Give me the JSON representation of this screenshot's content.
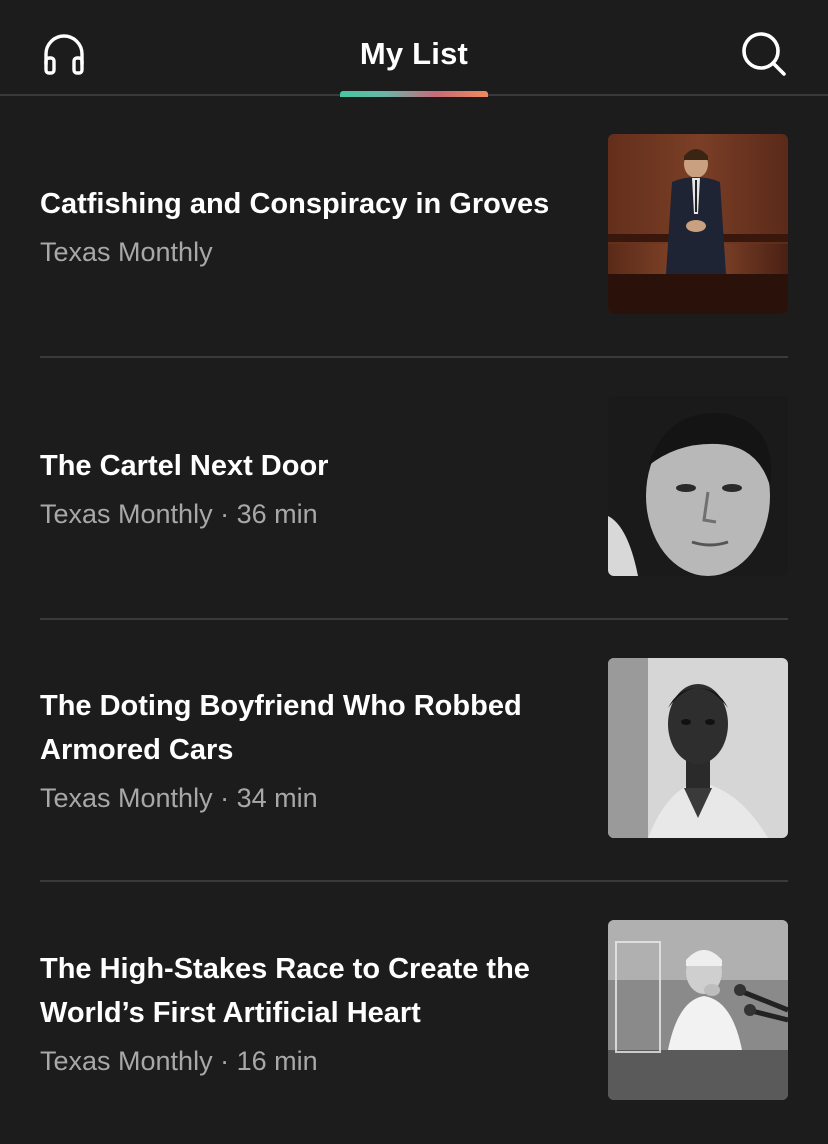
{
  "header": {
    "title": "My List",
    "left_icon": "headphones-icon",
    "right_icon": "search-icon",
    "tab_indicator_colors": [
      "#45c6a0",
      "#c86a78",
      "#f08a5a"
    ]
  },
  "items": [
    {
      "title": "Catfishing and Conspiracy in Groves",
      "meta": "Texas Monthly",
      "thumbnail": "man-in-suit-wood-panel-photo"
    },
    {
      "title": "The Cartel Next Door",
      "meta": "Texas Monthly · 36 min",
      "thumbnail": "man-portrait-bw-photo"
    },
    {
      "title": "The Doting Boyfriend Who Robbed Armored Cars",
      "meta": "Texas Monthly · 34 min",
      "thumbnail": "young-man-bw-photo"
    },
    {
      "title": "The High-Stakes Race to Create the World’s First Artificial Heart",
      "meta": "Texas Monthly · 16 min",
      "thumbnail": "doctor-press-conference-bw-photo"
    }
  ],
  "colors": {
    "background": "#1c1c1c",
    "divider": "#3a3a3a",
    "title_text": "#ffffff",
    "meta_text": "#a8a8a8"
  }
}
